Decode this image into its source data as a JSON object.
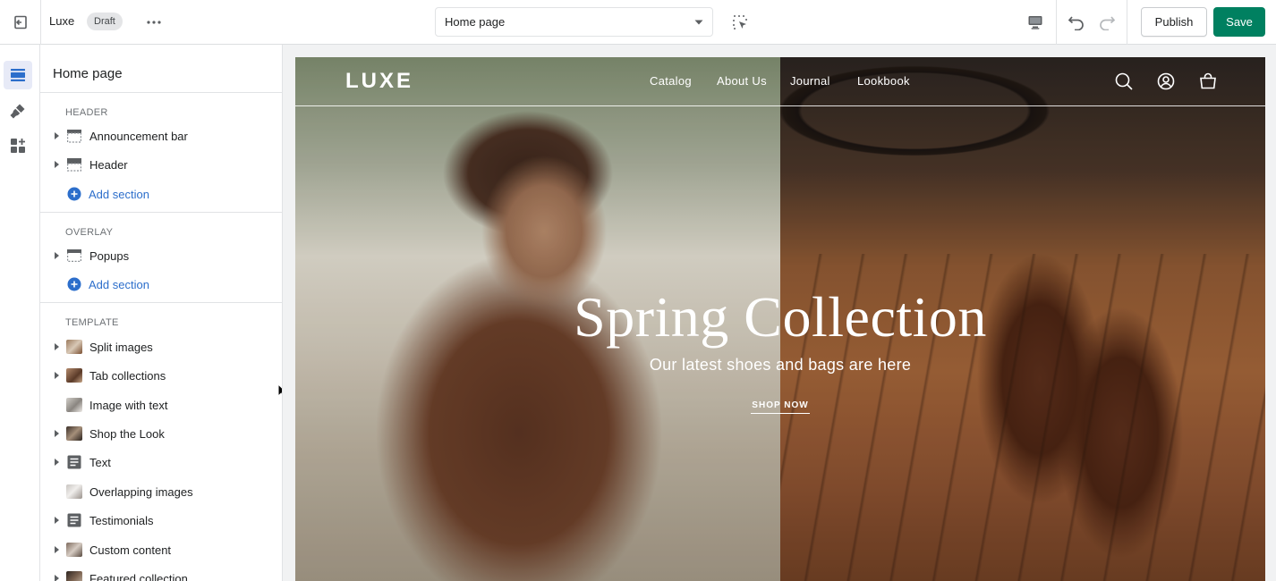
{
  "topbar": {
    "theme_name": "Luxe",
    "status_badge": "Draft",
    "page_selector_value": "Home page",
    "publish_label": "Publish",
    "save_label": "Save"
  },
  "colors": {
    "save_button": "#008060",
    "link_blue": "#2c6ecb",
    "active_rail": "#e7eaf7"
  },
  "rail": {
    "items": [
      {
        "icon": "sections-icon",
        "active": true
      },
      {
        "icon": "theme-settings-brush-icon",
        "active": false
      },
      {
        "icon": "app-embeds-icon",
        "active": false
      }
    ]
  },
  "sidebar": {
    "title": "Home page",
    "add_section_label": "Add section",
    "groups": [
      {
        "heading": "HEADER",
        "items": [
          {
            "label": "Announcement bar",
            "icon": "announcement-bar-icon",
            "expandable": true
          },
          {
            "label": "Header",
            "icon": "header-layout-icon",
            "expandable": true
          }
        ]
      },
      {
        "heading": "OVERLAY",
        "items": [
          {
            "label": "Popups",
            "icon": "popup-icon",
            "expandable": true
          }
        ]
      },
      {
        "heading": "TEMPLATE",
        "items": [
          {
            "label": "Split images",
            "icon": "image-thumbnail",
            "expandable": true
          },
          {
            "label": "Tab collections",
            "icon": "image-thumbnail",
            "expandable": true
          },
          {
            "label": "Image with text",
            "icon": "image-thumbnail",
            "expandable": false
          },
          {
            "label": "Shop the Look",
            "icon": "image-thumbnail",
            "expandable": true
          },
          {
            "label": "Text",
            "icon": "text-block-icon",
            "expandable": true
          },
          {
            "label": "Overlapping images",
            "icon": "image-thumbnail",
            "expandable": false
          },
          {
            "label": "Testimonials",
            "icon": "text-block-icon",
            "expandable": true
          },
          {
            "label": "Custom content",
            "icon": "image-thumbnail",
            "expandable": true
          },
          {
            "label": "Featured collection",
            "icon": "image-thumbnail",
            "expandable": true
          }
        ]
      }
    ]
  },
  "preview": {
    "logo": "LUXE",
    "nav": [
      "Catalog",
      "About Us",
      "Journal",
      "Lookbook"
    ],
    "icons": [
      "search-icon",
      "account-icon",
      "cart-icon"
    ],
    "hero_title": "Spring Collection",
    "hero_subtitle": "Our latest shoes and bags are here",
    "hero_cta": "SHOP NOW"
  }
}
